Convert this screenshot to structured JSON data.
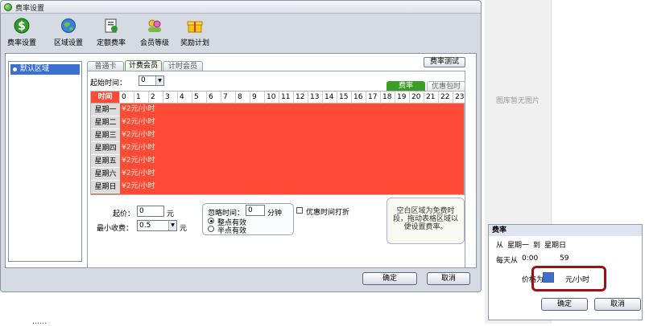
{
  "window": {
    "title": "费率设置"
  },
  "toolbar": {
    "items": [
      {
        "label": "费率设置",
        "icon": "dollar-icon"
      },
      {
        "label": "区域设置",
        "icon": "globe-icon"
      },
      {
        "label": "定额费率",
        "icon": "document-icon"
      },
      {
        "label": "会员等级",
        "icon": "members-icon"
      },
      {
        "label": "奖励计划",
        "icon": "gift-icon"
      }
    ]
  },
  "regions": {
    "items": [
      "默认区域"
    ]
  },
  "tabs": [
    "普通卡",
    "计费会员",
    "计时会员"
  ],
  "active_tab": "计费会员",
  "test_button": "费率测试",
  "start_time": {
    "label": "起始时间：",
    "value": "0"
  },
  "rate_tabs": {
    "rate": "费率",
    "discount": "优惠包时"
  },
  "grid": {
    "time_header": "时间",
    "hours": [
      "0",
      "1",
      "2",
      "3",
      "4",
      "5",
      "6",
      "7",
      "8",
      "9",
      "10",
      "11",
      "12",
      "13",
      "14",
      "15",
      "16",
      "17",
      "18",
      "19",
      "20",
      "21",
      "22",
      "23"
    ],
    "days": [
      "星期一",
      "星期二",
      "星期三",
      "星期四",
      "星期五",
      "星期六",
      "星期日"
    ],
    "rate_text": "¥2元/小时",
    "fill_color": "#ff4a36"
  },
  "form": {
    "start_price_label": "起价：",
    "start_price_value": "0",
    "start_price_unit": "元",
    "min_charge_label": "最小收费：",
    "min_charge_value": "0.5",
    "min_charge_unit": "元",
    "ignore_label": "忽略时间：",
    "ignore_value": "0",
    "ignore_unit": "分钟",
    "radio_whole": "整点有效",
    "radio_half": "半点有效",
    "discount_check": "优惠时间打折",
    "note": "空白区域为免费时段，拖动表格区域以便设置费率。"
  },
  "buttons": {
    "ok": "确定",
    "cancel": "取消"
  },
  "right": {
    "no_image": "图库暂无图片",
    "popup": {
      "title": "费率",
      "from": "从",
      "day_from": "星期一",
      "to": "到",
      "day_to": "星期日",
      "daily_prefix": "每天从",
      "time_from": "0:00",
      "time_to": "59",
      "price_label": "价格为",
      "unit": "元/小时",
      "ok": "确定",
      "cancel": "取消"
    }
  },
  "page_bottom": "……"
}
